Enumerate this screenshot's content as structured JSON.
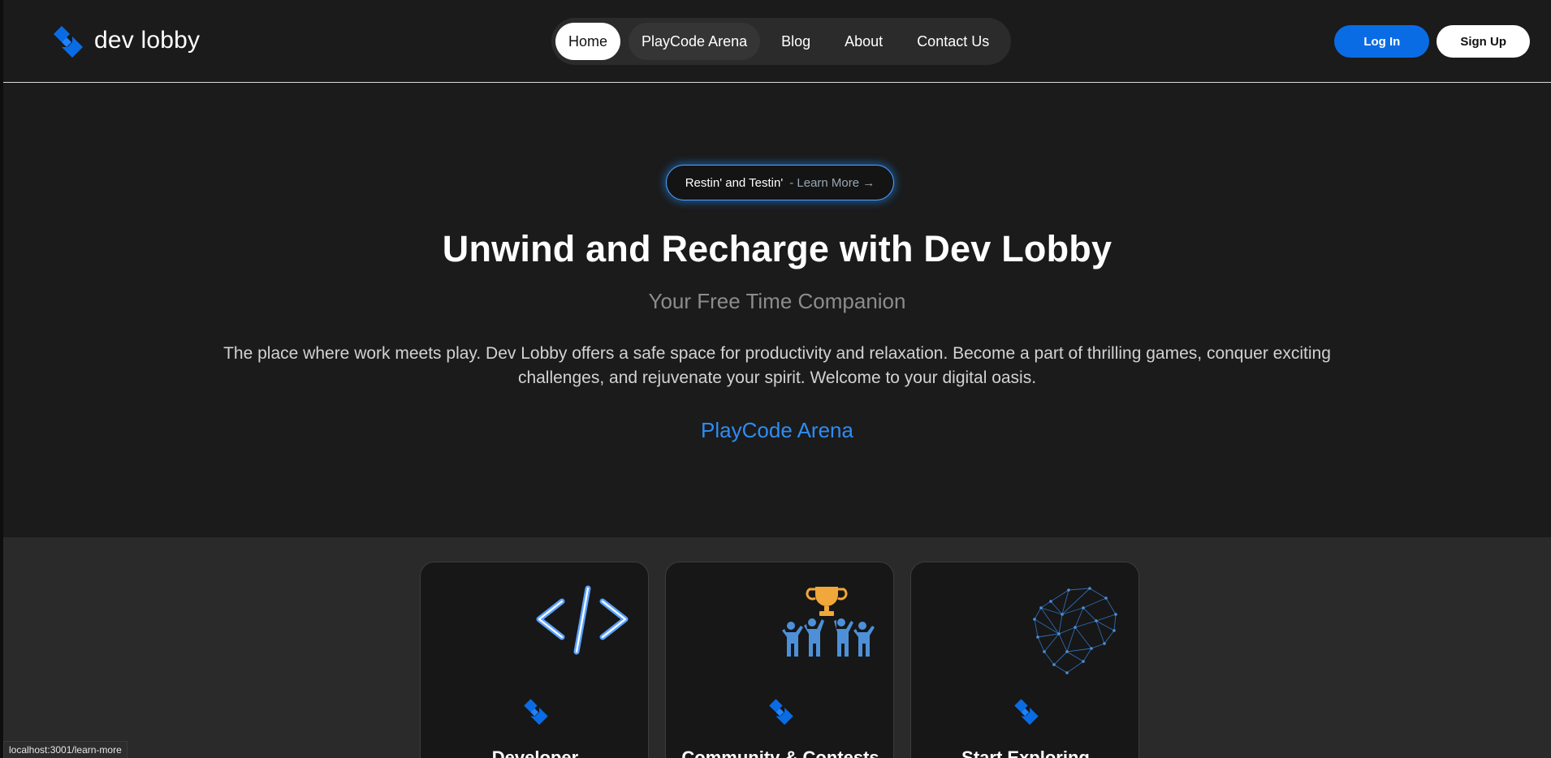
{
  "header": {
    "logo_text": "dev lobby",
    "nav": [
      {
        "label": "Home",
        "state": "active"
      },
      {
        "label": "PlayCode Arena",
        "state": "hover"
      },
      {
        "label": "Blog",
        "state": "normal"
      },
      {
        "label": "About",
        "state": "normal"
      },
      {
        "label": "Contact Us",
        "state": "normal"
      }
    ],
    "login_label": "Log In",
    "signup_label": "Sign Up"
  },
  "hero": {
    "pill_main": "Restin' and Testin'",
    "pill_link": "- Learn More →",
    "title": "Unwind and Recharge with Dev Lobby",
    "subtitle": "Your Free Time Companion",
    "description": "The place where work meets play. Dev Lobby offers a safe space for productivity and relaxation. Become a part of thrilling games, conquer exciting challenges, and rejuvenate your spirit. Welcome to your digital oasis.",
    "cta_link": "PlayCode Arena"
  },
  "features": {
    "cards": [
      {
        "title": "Developer",
        "icon": "code-brackets-icon"
      },
      {
        "title": "Community & Contests",
        "icon": "trophy-team-icon"
      },
      {
        "title": "Start Exploring",
        "icon": "wireframe-head-icon"
      }
    ]
  },
  "statusbar": {
    "url": "localhost:3001/learn-more"
  },
  "colors": {
    "accent": "#0a6ce4",
    "link": "#2e8cf4",
    "background": "#1b1b1b",
    "section_bg": "#2a2a2a"
  }
}
